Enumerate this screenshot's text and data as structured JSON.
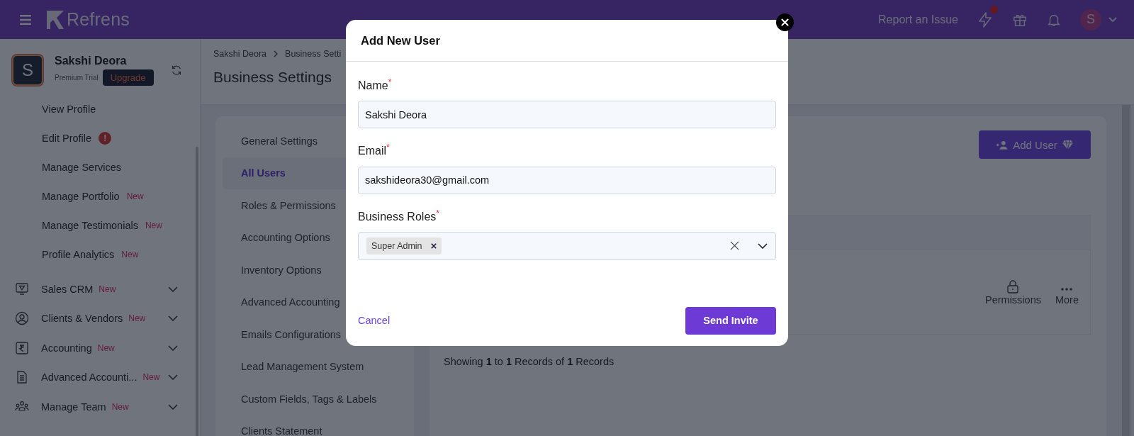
{
  "header": {
    "logo": "Refrens",
    "report_link": "Report an Issue",
    "alert_dot": true,
    "avatar": "S"
  },
  "sidebar": {
    "profile": {
      "initial": "S",
      "name": "Sakshi Deora",
      "plan": "Premium Trial",
      "upgrade": "Upgrade"
    },
    "profile_links": [
      {
        "label": "View Profile"
      },
      {
        "label": "Edit Profile",
        "alert": "!"
      },
      {
        "label": "Manage Services"
      },
      {
        "label": "Manage Portfolio",
        "badge": "New"
      },
      {
        "label": "Manage Testimonials",
        "badge": "New"
      },
      {
        "label": "Profile Analytics",
        "badge": "New"
      }
    ],
    "sections": [
      {
        "label": "Sales CRM",
        "badge": "New",
        "kind": "monitor",
        "expanded": false
      },
      {
        "label": "Clients & Vendors",
        "badge": "New",
        "kind": "person",
        "expanded": false
      },
      {
        "label": "Accounting",
        "badge": "New",
        "kind": "rupee",
        "expanded": false
      },
      {
        "label": "Advanced Accounti...",
        "badge": "New",
        "kind": "document",
        "expanded": false
      },
      {
        "label": "Manage Team",
        "badge": "New",
        "kind": "team",
        "expanded": false
      }
    ]
  },
  "breadcrumb": [
    "Sakshi Deora",
    "Business Setti"
  ],
  "page_title": "Business Settings",
  "settings_menu": [
    {
      "label": "General Settings",
      "selected": false
    },
    {
      "label": "All Users",
      "selected": true
    },
    {
      "label": "Roles & Permissions",
      "selected": false
    },
    {
      "label": "Accounting Options",
      "selected": false
    },
    {
      "label": "Inventory Options",
      "selected": false
    },
    {
      "label": "Advanced Accounting",
      "selected": false
    },
    {
      "label": "Emails Configurations",
      "selected": false
    },
    {
      "label": "Lead Management System",
      "selected": false
    },
    {
      "label": "Custom Fields, Tags & Labels",
      "selected": false
    },
    {
      "label": "Clients Statement",
      "selected": false
    }
  ],
  "users_panel": {
    "add_button": "Add User",
    "actions": [
      {
        "label": "Permissions",
        "kind": "lock"
      },
      {
        "label": "More",
        "kind": "dots"
      }
    ],
    "footer": "Showing **1** to **1** Records of **1** Records"
  },
  "modal": {
    "title": "Add New User",
    "fields": [
      {
        "label": "Name",
        "required_mark": "*",
        "value": "Sakshi Deora"
      },
      {
        "label": "Email",
        "required_mark": "*",
        "value": "sakshideora30@gmail.com"
      }
    ],
    "roles": {
      "label": "Business Roles",
      "required_mark": "*",
      "tags": [
        "Super Admin"
      ]
    },
    "cancel": "Cancel",
    "submit": "Send Invite"
  }
}
